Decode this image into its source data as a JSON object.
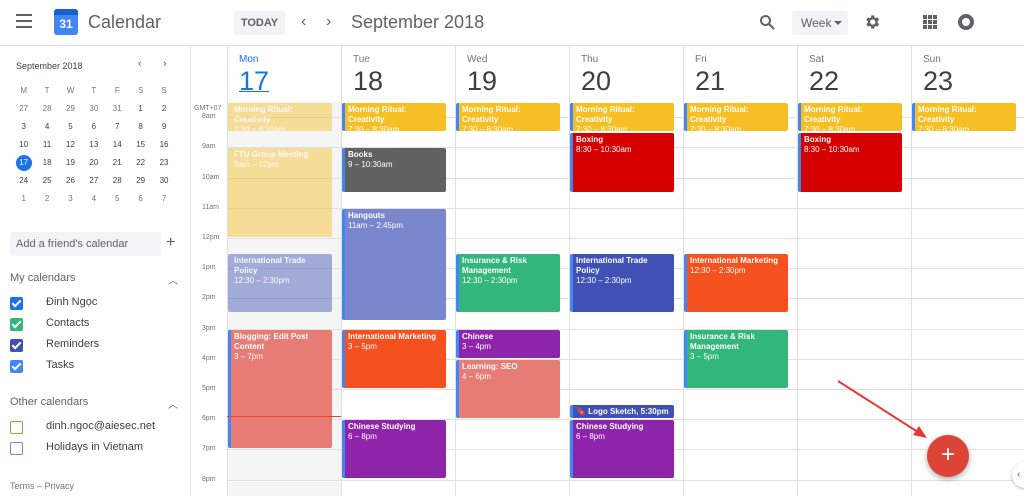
{
  "header": {
    "app_title": "Calendar",
    "logo_day": "31",
    "today_label": "TODAY",
    "prev_icon": "‹",
    "next_icon": "›",
    "month_title": "September 2018",
    "view_label": "Week"
  },
  "sidebar": {
    "mini_month": "September 2018",
    "mini_weekdays": [
      "M",
      "T",
      "W",
      "T",
      "F",
      "S",
      "S"
    ],
    "mini_weeks": [
      [
        "27",
        "28",
        "29",
        "30",
        "31",
        "1",
        "2"
      ],
      [
        "3",
        "4",
        "5",
        "6",
        "7",
        "8",
        "9"
      ],
      [
        "10",
        "11",
        "12",
        "13",
        "14",
        "15",
        "16"
      ],
      [
        "17",
        "18",
        "19",
        "20",
        "21",
        "22",
        "23"
      ],
      [
        "24",
        "25",
        "26",
        "27",
        "28",
        "29",
        "30"
      ],
      [
        "1",
        "2",
        "3",
        "4",
        "5",
        "6",
        "7"
      ]
    ],
    "friend_placeholder": "Add a friend's calendar",
    "my_calendars_title": "My calendars",
    "my_calendars": [
      {
        "label": "Đinh Ngọc",
        "color": "#1a73e8"
      },
      {
        "label": "Contacts",
        "color": "#33b679"
      },
      {
        "label": "Reminders",
        "color": "#3f51b5"
      },
      {
        "label": "Tasks",
        "color": "#4285f4"
      }
    ],
    "other_calendars_title": "Other calendars",
    "other_calendars": [
      {
        "label": "dinh.ngoc@aiesec.net",
        "color": "#7cb342"
      },
      {
        "label": "Holidays in Vietnam",
        "color": "#7986cb"
      }
    ],
    "terms": "Terms – Privacy"
  },
  "week": {
    "timezone": "GMT+07",
    "days": [
      {
        "name": "Mon",
        "num": "17",
        "today": true
      },
      {
        "name": "Tue",
        "num": "18"
      },
      {
        "name": "Wed",
        "num": "19"
      },
      {
        "name": "Thu",
        "num": "20"
      },
      {
        "name": "Fri",
        "num": "21"
      },
      {
        "name": "Sat",
        "num": "22"
      },
      {
        "name": "Sun",
        "num": "23"
      }
    ],
    "hours": [
      "8am",
      "9am",
      "10am",
      "11am",
      "12pm",
      "1pm",
      "2pm",
      "3pm",
      "4pm",
      "5pm",
      "6pm",
      "7pm",
      "8pm"
    ],
    "first_hour": 7.5,
    "events": [
      {
        "day": 0,
        "title": "Morning Ritual: Creativity",
        "time": "7:30 – 8:30am",
        "start": 7.5,
        "end": 8.5,
        "color": "#f6bf26",
        "faded": true
      },
      {
        "day": 1,
        "title": "Morning Ritual: Creativity",
        "time": "7:30 – 8:30am",
        "start": 7.5,
        "end": 8.5,
        "color": "#f6bf26"
      },
      {
        "day": 2,
        "title": "Morning Ritual: Creativity",
        "time": "7:30 – 8:30am",
        "start": 7.5,
        "end": 8.5,
        "color": "#f6bf26"
      },
      {
        "day": 3,
        "title": "Morning Ritual: Creativity",
        "time": "7:30 – 8:30am",
        "start": 7.5,
        "end": 8.5,
        "color": "#f6bf26"
      },
      {
        "day": 4,
        "title": "Morning Ritual: Creativity",
        "time": "7:30 – 8:30am",
        "start": 7.5,
        "end": 8.5,
        "color": "#f6bf26"
      },
      {
        "day": 5,
        "title": "Morning Ritual: Creativity",
        "time": "7:30 – 8:30am",
        "start": 7.5,
        "end": 8.5,
        "color": "#f6bf26"
      },
      {
        "day": 6,
        "title": "Morning Ritual: Creativity",
        "time": "7:30 – 8:30am",
        "start": 7.5,
        "end": 8.5,
        "color": "#f6bf26"
      },
      {
        "day": 0,
        "title": "FTU Group Meeting",
        "time": "9am – 12pm",
        "start": 9,
        "end": 12,
        "color": "#f6bf26",
        "faded": true
      },
      {
        "day": 0,
        "title": "International Trade Policy",
        "time": "12:30 – 2:30pm",
        "start": 12.5,
        "end": 14.5,
        "color": "#3f51b5",
        "faded": true
      },
      {
        "day": 0,
        "title": "Blogging: Edit Post Content",
        "time": "3 – 7pm",
        "start": 15,
        "end": 19,
        "color": "#e67c73"
      },
      {
        "day": 1,
        "title": "Books",
        "time": "9 – 10:30am",
        "start": 9,
        "end": 10.5,
        "color": "#616161"
      },
      {
        "day": 1,
        "title": "Hangouts",
        "time": "11am – 2:45pm",
        "start": 11,
        "end": 14.75,
        "color": "#7986cb"
      },
      {
        "day": 1,
        "title": "International Marketing",
        "time": "3 – 5pm",
        "start": 15,
        "end": 17,
        "color": "#f4511e"
      },
      {
        "day": 1,
        "title": "Chinese Studying",
        "time": "6 – 8pm",
        "start": 18,
        "end": 20,
        "color": "#8e24aa"
      },
      {
        "day": 2,
        "title": "Insurance & Risk Management",
        "time": "12:30 – 2:30pm",
        "start": 12.5,
        "end": 14.5,
        "color": "#33b679"
      },
      {
        "day": 2,
        "title": "Chinese",
        "time": "3 – 4pm",
        "start": 15,
        "end": 16,
        "color": "#8e24aa"
      },
      {
        "day": 2,
        "title": "Learning: SEO",
        "time": "4 – 6pm",
        "start": 16,
        "end": 18,
        "color": "#e67c73"
      },
      {
        "day": 3,
        "title": "Boxing",
        "time": "8:30 – 10:30am",
        "start": 8.5,
        "end": 10.5,
        "color": "#d50000"
      },
      {
        "day": 3,
        "title": "International Trade Policy",
        "time": "12:30 – 2:30pm",
        "start": 12.5,
        "end": 14.5,
        "color": "#3f51b5"
      },
      {
        "day": 3,
        "title": "🔖 Logo Sketch, 5:30pm",
        "time": "",
        "start": 17.5,
        "end": 18,
        "color": "#3f51b5"
      },
      {
        "day": 3,
        "title": "Chinese Studying",
        "time": "6 – 8pm",
        "start": 18,
        "end": 20,
        "color": "#8e24aa"
      },
      {
        "day": 4,
        "title": "International Marketing",
        "time": "12:30 – 2:30pm",
        "start": 12.5,
        "end": 14.5,
        "color": "#f4511e"
      },
      {
        "day": 4,
        "title": "Insurance & Risk Management",
        "time": "3 – 5pm",
        "start": 15,
        "end": 17,
        "color": "#33b679"
      },
      {
        "day": 5,
        "title": "Boxing",
        "time": "8:30 – 10:30am",
        "start": 8.5,
        "end": 10.5,
        "color": "#d50000"
      }
    ]
  },
  "fab_label": "+",
  "side_toggle": "‹"
}
